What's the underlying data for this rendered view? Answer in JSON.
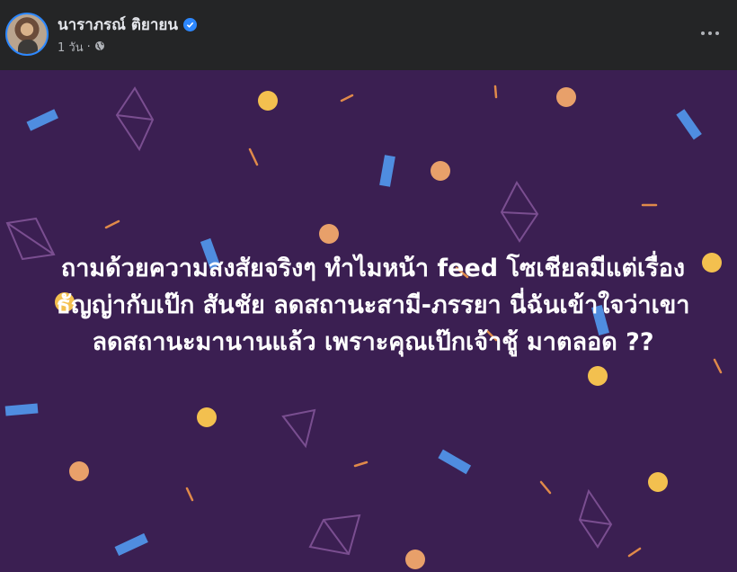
{
  "post": {
    "author_name": "นาราภรณ์ ติยายน",
    "verified": true,
    "timestamp": "1 วัน",
    "privacy": "globe-icon",
    "more_menu": "more-options-icon",
    "text": "ถามด้วยความสงสัยจริงๆ ทำไมหน้า feed โซเชียลมีแต่เรื่อง ธัญญ่ากับเป๊ก สันชัย ลดสถานะสามี-ภรรยา นี่ฉันเข้าใจว่าเขาลดสถานะมานานแล้ว เพราะคุณเป๊กเจ้าชู้ มาตลอด ??"
  },
  "colors": {
    "header_bg": "#242526",
    "post_bg": "#3b1f52",
    "text": "#ffffff",
    "verified_badge": "#2d88ff"
  }
}
